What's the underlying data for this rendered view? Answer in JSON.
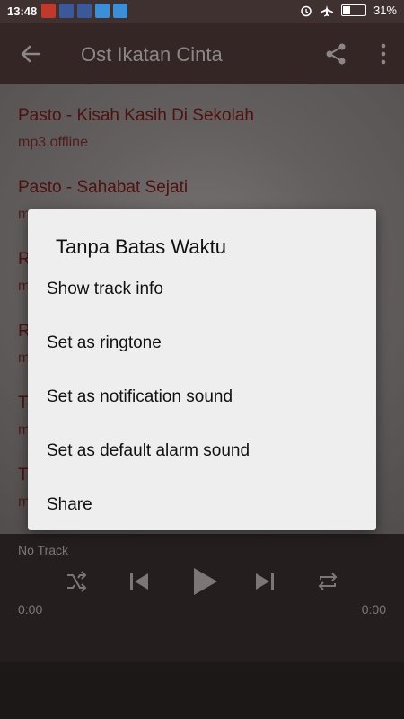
{
  "status_bar": {
    "time": "13:48",
    "battery": "31%"
  },
  "app_bar": {
    "title": "Ost Ikatan Cinta"
  },
  "tracks": [
    {
      "name": "Pasto - Kisah Kasih Di Sekolah",
      "sub": "mp3 offline"
    },
    {
      "name": "Pasto - Sahabat Sejati",
      "sub": "m"
    },
    {
      "name": "R",
      "sub": "m"
    },
    {
      "name": "R",
      "sub": "m"
    },
    {
      "name": "T",
      "sub": "m"
    },
    {
      "name": "T",
      "sub": "m"
    }
  ],
  "player": {
    "status": "No Track",
    "elapsed": "0:00",
    "total": "0:00"
  },
  "dialog": {
    "title": "Tanpa Batas Waktu",
    "items": [
      "Show track info",
      "Set as ringtone",
      "Set as notification sound",
      "Set as default alarm sound",
      "Share"
    ]
  },
  "colors": {
    "appbar": "#523b3b",
    "track_text": "#7a1a1a",
    "dialog_bg": "#eeeeee"
  }
}
